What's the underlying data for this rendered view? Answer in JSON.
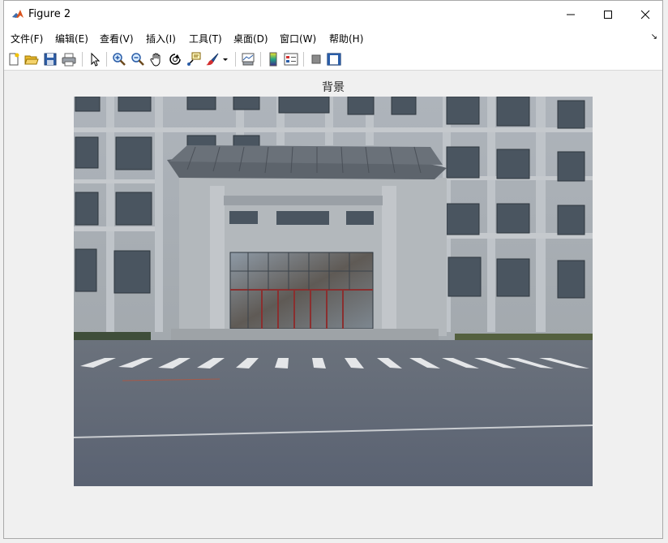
{
  "window": {
    "title": "Figure 2",
    "controls": [
      "minimize",
      "maximize",
      "close"
    ]
  },
  "menu": {
    "items": [
      "文件(F)",
      "编辑(E)",
      "查看(V)",
      "插入(I)",
      "工具(T)",
      "桌面(D)",
      "窗口(W)",
      "帮助(H)"
    ]
  },
  "toolbar": {
    "buttons": [
      "new-figure-icon",
      "open-file-icon",
      "save-icon",
      "print-icon",
      "edit-plot-arrow-icon",
      "zoom-in-icon",
      "zoom-out-icon",
      "pan-hand-icon",
      "rotate-3d-icon",
      "data-cursor-icon",
      "brush-icon",
      "link-plot-icon",
      "insert-colorbar-icon",
      "insert-legend-icon",
      "hide-plot-tools-icon",
      "show-plot-tools-icon"
    ]
  },
  "axes": {
    "title": "背景"
  },
  "image": {
    "subject": "photograph",
    "colors": {
      "sky": "#8a9bb0",
      "wall": "#b7bcc0",
      "road": "#5c6676",
      "roof": "#5d646c"
    }
  }
}
